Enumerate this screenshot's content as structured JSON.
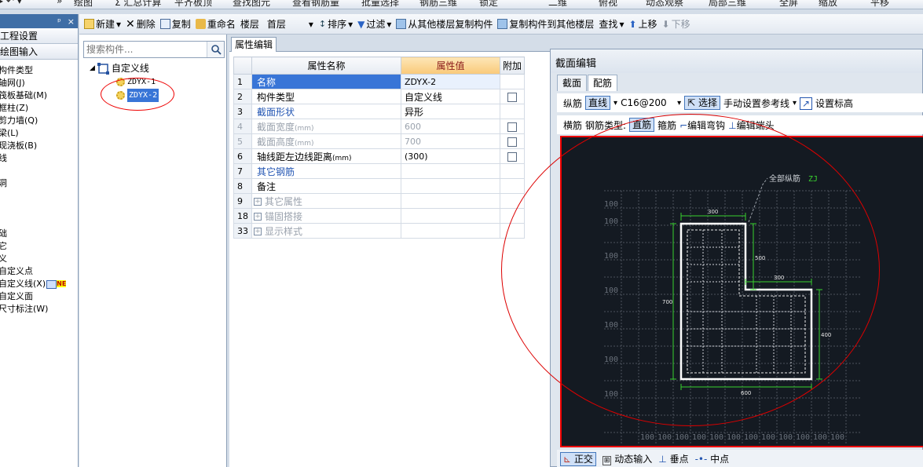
{
  "top_toolbar": {
    "items": [
      "»",
      "绘图",
      "Σ 汇总计算",
      "平齐板顶",
      "查找图元",
      "查看钢筋量",
      "批量选择",
      "钢筋三维",
      "锁定",
      "二维",
      "俯视",
      "动态观察",
      "局部三维",
      "全屏",
      "缩放",
      "平移"
    ]
  },
  "left_panel": {
    "pin": "ᵖ",
    "close": "×",
    "section1": "工程设置",
    "section2": "绘图输入",
    "items": [
      "构件类型",
      "轴网(J)",
      "筏板基础(M)",
      "框柱(Z)",
      "剪力墙(Q)",
      "梁(L)",
      "现浇板(B)",
      "线",
      "",
      "洞",
      "",
      "",
      "",
      "础",
      "它",
      "义",
      "自定义点",
      "自定义线(X)",
      "自定义面",
      "尺寸标注(W)"
    ],
    "ne_tag": "NE"
  },
  "comp_toolbar": {
    "new": "新建",
    "delete": "删除",
    "copy": "复制",
    "rename": "重命名",
    "floor_label": "楼层",
    "floor_value": "首层",
    "sort": "排序",
    "filter": "过滤",
    "copy_from": "从其他楼层复制构件",
    "copy_to": "复制构件到其他楼层",
    "find": "查找",
    "move_up": "上移",
    "move_down": "下移"
  },
  "search": {
    "placeholder": "搜索构件..."
  },
  "tree": {
    "root": "自定义线",
    "children": [
      "ZDYX-1",
      "ZDYX-2"
    ]
  },
  "prop_tab": "属性编辑",
  "prop_table": {
    "headers": [
      "属性名称",
      "属性值",
      "附加"
    ],
    "rows": [
      {
        "num": "1",
        "name": "名称",
        "value": "ZDYX-2",
        "check": false
      },
      {
        "num": "2",
        "name": "构件类型",
        "value": "自定义线",
        "check": true
      },
      {
        "num": "3",
        "name": "截面形状",
        "value": "异形",
        "check": false
      },
      {
        "num": "4",
        "name": "截面宽度",
        "unit": "(mm)",
        "value": "600",
        "check": true
      },
      {
        "num": "5",
        "name": "截面高度",
        "unit": "(mm)",
        "value": "700",
        "check": true
      },
      {
        "num": "6",
        "name": "轴线距左边线距离",
        "unit": "(mm)",
        "value": "(300)",
        "check": true
      },
      {
        "num": "7",
        "name": "其它钢筋",
        "value": "",
        "check": false
      },
      {
        "num": "8",
        "name": "备注",
        "value": "",
        "check": false
      },
      {
        "num": "9",
        "name": "其它属性",
        "value": "",
        "check": false
      },
      {
        "num": "18",
        "name": "锚固搭接",
        "value": "",
        "check": false
      },
      {
        "num": "33",
        "name": "显示样式",
        "value": "",
        "check": false
      }
    ]
  },
  "dialog": {
    "title": "截面编辑",
    "tabs": [
      "截面",
      "配筋"
    ],
    "row1": {
      "label": "纵筋",
      "line_type": "直线",
      "rebar": "C16@200",
      "select": "选择",
      "manual_ref": "手动设置参考线",
      "set_elev": "设置标高"
    },
    "row2": {
      "label": "横筋",
      "type_label": "钢筋类型:",
      "straight": "直筋",
      "stirrup": "箍筋",
      "edit_hook": "编辑弯钩",
      "edit_end": "编辑端头"
    },
    "canvas": {
      "annotation": "全部纵筋",
      "annotation_tag": "ZJ",
      "dims": {
        "top": "300",
        "right_upper": "500",
        "step": "300",
        "left": "700",
        "right_lower": "400",
        "bottom": "600"
      },
      "grid_label": "100",
      "colors": {
        "bg": "#141a22",
        "outline": "#ffffff",
        "dim": "#39d12f",
        "grid": "#5a616b"
      }
    },
    "status": {
      "ortho": "正交",
      "dynamic_input": "动态输入",
      "perpendicular": "垂点",
      "midpoint": "中点"
    }
  }
}
